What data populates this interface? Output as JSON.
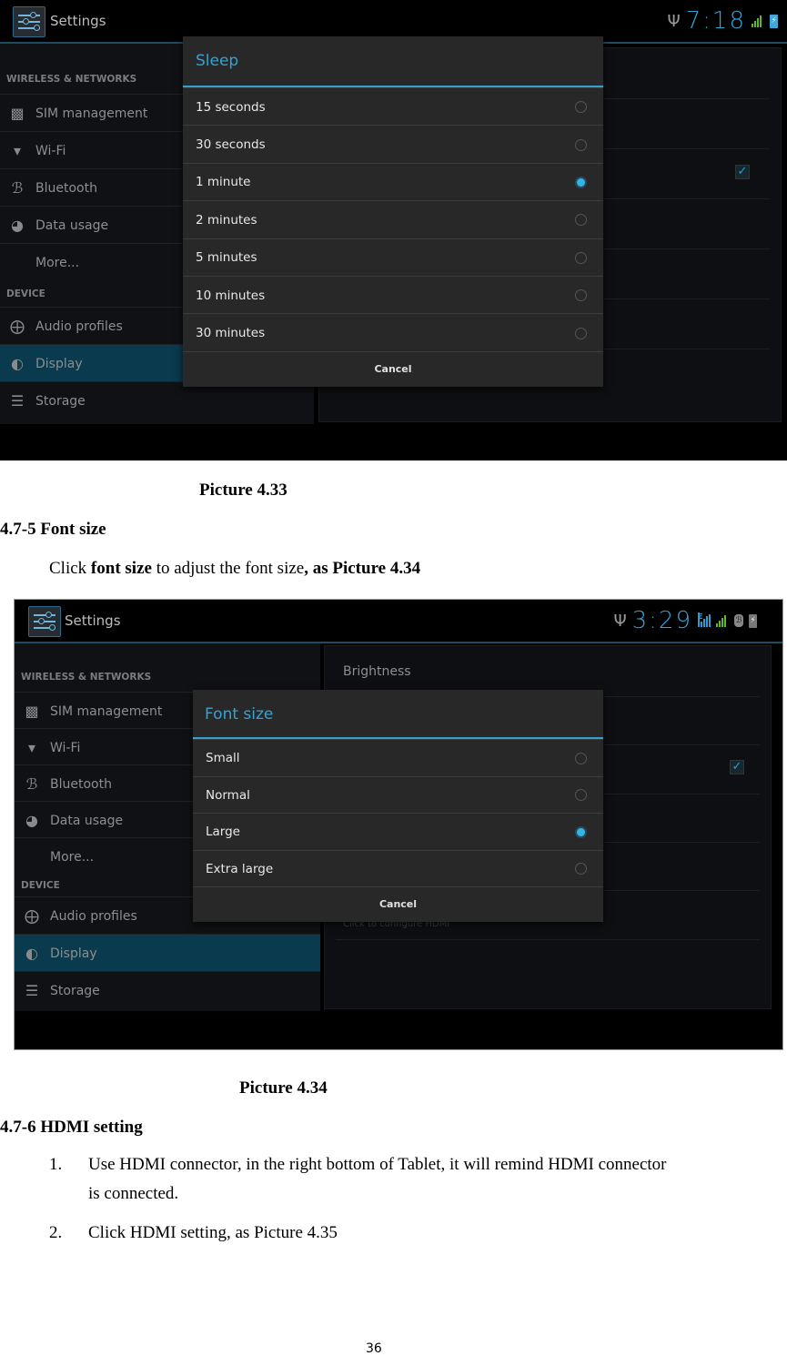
{
  "screenshot1": {
    "app_title": "Settings",
    "status": {
      "time": "7:18",
      "icons": [
        "usb-icon",
        "signal-icon",
        "battery-charging-icon"
      ]
    },
    "sidebar": {
      "sections": [
        {
          "header": "WIRELESS & NETWORKS",
          "items": [
            {
              "label": "SIM management",
              "icon": "sim-icon"
            },
            {
              "label": "Wi-Fi",
              "icon": "wifi-icon"
            },
            {
              "label": "Bluetooth",
              "icon": "bluetooth-icon"
            },
            {
              "label": "Data usage",
              "icon": "data-usage-icon"
            },
            {
              "label": "More...",
              "icon": ""
            }
          ]
        },
        {
          "header": "DEVICE",
          "items": [
            {
              "label": "Audio profiles",
              "icon": "audio-profiles-icon"
            },
            {
              "label": "Display",
              "icon": "display-icon",
              "selected": true
            },
            {
              "label": "Storage",
              "icon": "storage-icon"
            }
          ]
        }
      ]
    },
    "dialog": {
      "title": "Sleep",
      "options": [
        "15 seconds",
        "30 seconds",
        "1 minute",
        "2 minutes",
        "5 minutes",
        "10 minutes",
        "30 minutes"
      ],
      "selected": "1 minute",
      "cancel_label": "Cancel"
    },
    "caption": "Picture 4.33"
  },
  "section_font": {
    "heading": "4.7-5 Font size",
    "para": {
      "p1": "Click ",
      "p2": "font size",
      "p3": " to adjust the font size",
      "p4": ", as Picture 4.34"
    }
  },
  "screenshot2": {
    "app_title": "Settings",
    "status": {
      "time": "3:29",
      "network_type": "E",
      "icons": [
        "usb-icon",
        "data-signal-icon",
        "signal-icon",
        "bluetooth-icon",
        "battery-charging-icon"
      ]
    },
    "sidebar": {
      "sections": [
        {
          "header": "WIRELESS & NETWORKS",
          "items": [
            {
              "label": "SIM management"
            },
            {
              "label": "Wi-Fi"
            },
            {
              "label": "Bluetooth"
            },
            {
              "label": "Data usage"
            },
            {
              "label": "More..."
            }
          ]
        },
        {
          "header": "DEVICE",
          "items": [
            {
              "label": "Audio profiles"
            },
            {
              "label": "Display",
              "selected": true
            },
            {
              "label": "Storage"
            }
          ]
        }
      ]
    },
    "right_pane": {
      "brightness_label": "Brightness",
      "hdmi_summary": "Click to configure HDMI"
    },
    "dialog": {
      "title": "Font size",
      "options": [
        "Small",
        "Normal",
        "Large",
        "Extra large"
      ],
      "selected": "Large",
      "cancel_label": "Cancel"
    },
    "caption": "Picture 4.34"
  },
  "section_hdmi": {
    "heading": "4.7-6 HDMI setting",
    "list": [
      {
        "num": "1.",
        "line1": "Use HDMI connector, in the right bottom of Tablet, it will remind HDMI connector",
        "line2": "is connected."
      },
      {
        "num": "2.",
        "line1": "Click HDMI setting, as Picture 4.35"
      }
    ]
  },
  "page_number": "36",
  "colors": {
    "accent": "#33b5e5",
    "dialog_bg": "#282828",
    "selected_item_bg": "#0a3a4e"
  }
}
